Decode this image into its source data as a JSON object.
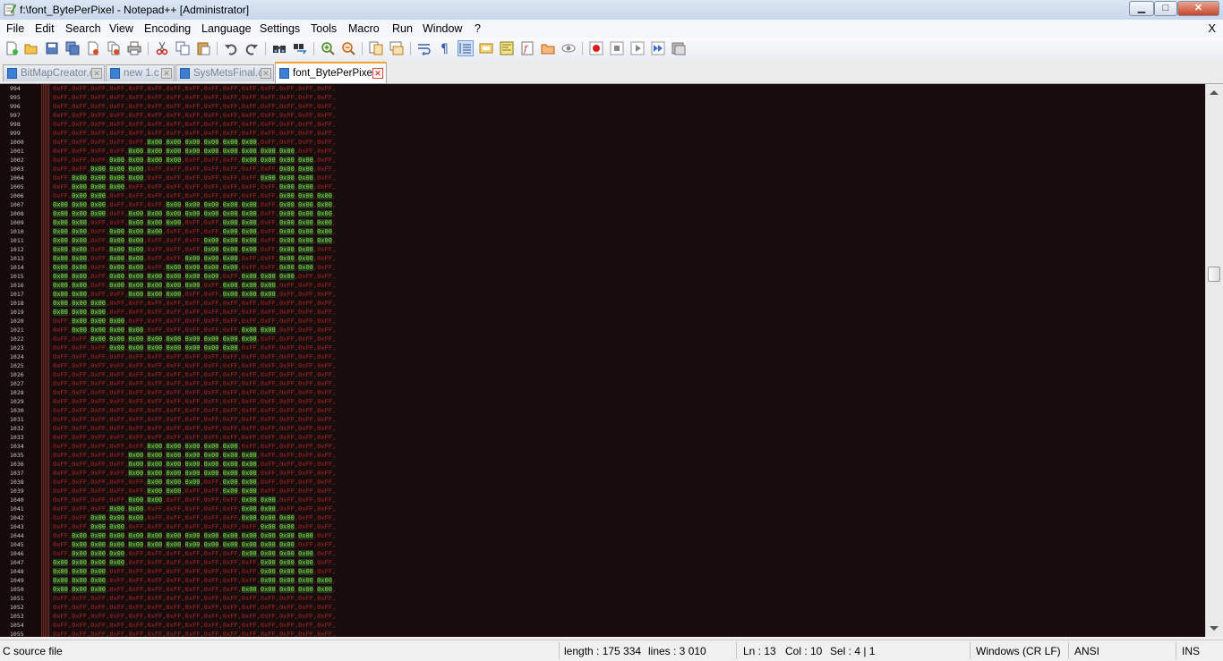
{
  "window": {
    "title": "f:\\font_BytePerPixel - Notepad++ [Administrator]",
    "min_glyph": "▁",
    "max_glyph": "□",
    "close_glyph": "✕",
    "menu_close": "X"
  },
  "menu": {
    "items": [
      "File",
      "Edit",
      "Search",
      "View",
      "Encoding",
      "Language",
      "Settings",
      "Tools",
      "Macro",
      "Run",
      "Window",
      "?"
    ]
  },
  "toolbar": {
    "icons": [
      "new-file-icon",
      "open-file-icon",
      "save-icon",
      "save-all-icon",
      "close-icon",
      "close-all-icon",
      "print-icon",
      "cut-icon",
      "copy-icon",
      "paste-icon",
      "undo-icon",
      "redo-icon",
      "find-icon",
      "replace-icon",
      "zoom-in-icon",
      "zoom-out-icon",
      "sync-vertical-icon",
      "sync-horizontal-icon",
      "word-wrap-icon",
      "show-all-chars-icon",
      "indent-guide-icon",
      "user-language-icon",
      "doc-map-icon",
      "function-list-icon",
      "folder-icon",
      "monitor-icon",
      "record-macro-icon",
      "stop-record-icon",
      "play-macro-icon",
      "run-multiple-macro-icon",
      "save-macro-icon"
    ]
  },
  "tabs": [
    {
      "label": "BitMapCreator.c",
      "active": false
    },
    {
      "label": "new  1.c",
      "active": false
    },
    {
      "label": "SysMetsFinal.c",
      "active": false
    },
    {
      "label": "font_BytePerPixel",
      "active": true
    }
  ],
  "editor": {
    "line_numbers": [
      "994",
      "995",
      "996",
      "997",
      "998",
      "999",
      "1000",
      "1001",
      "1002",
      "1003",
      "1004",
      "1005",
      "1006",
      "1007",
      "1008",
      "1009",
      "1010",
      "1011",
      "1012",
      "1013",
      "1014",
      "1015",
      "1016",
      "1017",
      "1018",
      "1019",
      "1020",
      "1021",
      "1022",
      "1023",
      "1024",
      "1025",
      "1026",
      "1027",
      "1028",
      "1029",
      "1030",
      "1031",
      "1032",
      "1033",
      "1034",
      "1035",
      "1036",
      "1037",
      "1038",
      "1039",
      "1040",
      "1041",
      "1042",
      "1043",
      "1044",
      "1045",
      "1046",
      "1047",
      "1048",
      "1049",
      "1050",
      "1051",
      "1052",
      "1053",
      "1054",
      "1055"
    ],
    "lines": [
      "0xFF,0xFF,0xFF,0xFF,0xFF,0xFF,0xFF,0xFF,0xFF,0xFF,0xFF,0xFF,0xFF,0xFF,0xFF,",
      "0xFF,0xFF,0xFF,0xFF,0xFF,0xFF,0xFF,0xFF,0xFF,0xFF,0xFF,0xFF,0xFF,0xFF,0xFF,",
      "0xFF,0xFF,0xFF,0xFF,0xFF,0xFF,0xFF,0xFF,0xFF,0xFF,0xFF,0xFF,0xFF,0xFF,0xFF,",
      "0xFF,0xFF,0xFF,0xFF,0xFF,0xFF,0xFF,0xFF,0xFF,0xFF,0xFF,0xFF,0xFF,0xFF,0xFF,",
      "0xFF,0xFF,0xFF,0xFF,0xFF,0xFF,0xFF,0xFF,0xFF,0xFF,0xFF,0xFF,0xFF,0xFF,0xFF,",
      "0xFF,0xFF,0xFF,0xFF,0xFF,0xFF,0xFF,0xFF,0xFF,0xFF,0xFF,0xFF,0xFF,0xFF,0xFF,",
      "0xFF,0xFF,0xFF,0xFF,0xFF,0x00,0x00,0x00,0x00,0x00,0x00,0xFF,0xFF,0xFF,0xFF,",
      "0xFF,0xFF,0xFF,0xFF,0x00,0x00,0x00,0x00,0x00,0x00,0x00,0x00,0x00,0xFF,0xFF,",
      "0xFF,0xFF,0xFF,0x00,0x00,0x00,0x00,0xFF,0xFF,0xFF,0x00,0x00,0x00,0x00,0xFF,",
      "0xFF,0xFF,0x00,0x00,0x00,0xFF,0xFF,0xFF,0xFF,0xFF,0xFF,0xFF,0x00,0x00,0xFF,",
      "0xFF,0x00,0x00,0x00,0x00,0xFF,0xFF,0xFF,0xFF,0xFF,0xFF,0x00,0x00,0x00,0xFF,",
      "0xFF,0x00,0x00,0x00,0xFF,0xFF,0xFF,0xFF,0xFF,0xFF,0xFF,0xFF,0x00,0x00,0xFF,",
      "0xFF,0x00,0x00,0xFF,0xFF,0xFF,0xFF,0xFF,0xFF,0xFF,0xFF,0xFF,0x00,0x00,0x00,",
      "0x00,0x00,0x00,0xFF,0xFF,0xFF,0x00,0x00,0x00,0x00,0x00,0xFF,0x00,0x00,0x00,",
      "0x00,0x00,0x00,0xFF,0x00,0x00,0x00,0x00,0x00,0x00,0x00,0xFF,0x00,0x00,0x00,",
      "0x00,0x00,0xFF,0xFF,0x00,0x00,0x00,0xFF,0xFF,0x00,0x00,0xFF,0x00,0x00,0x00,",
      "0x00,0x00,0xFF,0x00,0x00,0x00,0xFF,0xFF,0xFF,0x00,0x00,0xFF,0x00,0x00,0x00,",
      "0x00,0x00,0xFF,0x00,0x00,0xFF,0xFF,0xFF,0x00,0x00,0x00,0xFF,0x00,0x00,0x00,",
      "0x00,0x00,0xFF,0x00,0x00,0xFF,0xFF,0xFF,0x00,0x00,0x00,0xFF,0x00,0x00,0xFF,",
      "0x00,0x00,0xFF,0x00,0x00,0xFF,0xFF,0x00,0x00,0x00,0xFF,0xFF,0x00,0x00,0xFF,",
      "0x00,0x00,0xFF,0x00,0x00,0xFF,0x00,0x00,0x00,0x00,0xFF,0xFF,0x00,0x00,0xFF,",
      "0x00,0x00,0xFF,0x00,0x00,0x00,0x00,0x00,0x00,0xFF,0x00,0x00,0x00,0xFF,0xFF,",
      "0x00,0x00,0xFF,0x00,0x00,0x00,0x00,0x00,0xFF,0x00,0x00,0x00,0xFF,0xFF,0xFF,",
      "0x00,0x00,0xFF,0xFF,0x00,0x00,0x00,0xFF,0xFF,0x00,0x00,0x00,0xFF,0xFF,0xFF,",
      "0x00,0x00,0x00,0xFF,0xFF,0xFF,0xFF,0xFF,0xFF,0xFF,0xFF,0xFF,0xFF,0xFF,0xFF,",
      "0x00,0x00,0x00,0xFF,0xFF,0xFF,0xFF,0xFF,0xFF,0xFF,0xFF,0xFF,0xFF,0xFF,0xFF,",
      "0xFF,0x00,0x00,0x00,0xFF,0xFF,0xFF,0xFF,0xFF,0xFF,0xFF,0xFF,0xFF,0xFF,0xFF,",
      "0xFF,0x00,0x00,0x00,0x00,0xFF,0xFF,0xFF,0xFF,0xFF,0x00,0x00,0xFF,0xFF,0xFF,",
      "0xFF,0xFF,0x00,0x00,0x00,0x00,0x00,0x00,0x00,0x00,0x00,0xFF,0xFF,0xFF,0xFF,",
      "0xFF,0xFF,0xFF,0x00,0x00,0x00,0x00,0x00,0x00,0x00,0xFF,0xFF,0xFF,0xFF,0xFF,",
      "0xFF,0xFF,0xFF,0xFF,0xFF,0xFF,0xFF,0xFF,0xFF,0xFF,0xFF,0xFF,0xFF,0xFF,0xFF,",
      "0xFF,0xFF,0xFF,0xFF,0xFF,0xFF,0xFF,0xFF,0xFF,0xFF,0xFF,0xFF,0xFF,0xFF,0xFF,",
      "0xFF,0xFF,0xFF,0xFF,0xFF,0xFF,0xFF,0xFF,0xFF,0xFF,0xFF,0xFF,0xFF,0xFF,0xFF,",
      "0xFF,0xFF,0xFF,0xFF,0xFF,0xFF,0xFF,0xFF,0xFF,0xFF,0xFF,0xFF,0xFF,0xFF,0xFF,",
      "0xFF,0xFF,0xFF,0xFF,0xFF,0xFF,0xFF,0xFF,0xFF,0xFF,0xFF,0xFF,0xFF,0xFF,0xFF,",
      "0xFF,0xFF,0xFF,0xFF,0xFF,0xFF,0xFF,0xFF,0xFF,0xFF,0xFF,0xFF,0xFF,0xFF,0xFF,",
      "0xFF,0xFF,0xFF,0xFF,0xFF,0xFF,0xFF,0xFF,0xFF,0xFF,0xFF,0xFF,0xFF,0xFF,0xFF,",
      "0xFF,0xFF,0xFF,0xFF,0xFF,0xFF,0xFF,0xFF,0xFF,0xFF,0xFF,0xFF,0xFF,0xFF,0xFF,",
      "0xFF,0xFF,0xFF,0xFF,0xFF,0xFF,0xFF,0xFF,0xFF,0xFF,0xFF,0xFF,0xFF,0xFF,0xFF,",
      "0xFF,0xFF,0xFF,0xFF,0xFF,0xFF,0xFF,0xFF,0xFF,0xFF,0xFF,0xFF,0xFF,0xFF,0xFF,",
      "0xFF,0xFF,0xFF,0xFF,0xFF,0x00,0x00,0x00,0x00,0x00,0xFF,0xFF,0xFF,0xFF,0xFF,",
      "0xFF,0xFF,0xFF,0xFF,0x00,0x00,0x00,0x00,0x00,0x00,0x00,0xFF,0xFF,0xFF,0xFF,",
      "0xFF,0xFF,0xFF,0xFF,0x00,0x00,0x00,0x00,0x00,0x00,0x00,0xFF,0xFF,0xFF,0xFF,",
      "0xFF,0xFF,0xFF,0xFF,0x00,0x00,0x00,0x00,0x00,0x00,0x00,0xFF,0xFF,0xFF,0xFF,",
      "0xFF,0xFF,0xFF,0xFF,0xFF,0x00,0x00,0x00,0xFF,0x00,0x00,0xFF,0xFF,0xFF,0xFF,",
      "0xFF,0xFF,0xFF,0xFF,0xFF,0x00,0x00,0xFF,0xFF,0x00,0x00,0xFF,0xFF,0xFF,0xFF,",
      "0xFF,0xFF,0xFF,0xFF,0x00,0x00,0xFF,0xFF,0xFF,0xFF,0x00,0x00,0xFF,0xFF,0xFF,",
      "0xFF,0xFF,0xFF,0x00,0x00,0xFF,0xFF,0xFF,0xFF,0xFF,0x00,0x00,0xFF,0xFF,0xFF,",
      "0xFF,0xFF,0x00,0x00,0x00,0xFF,0xFF,0xFF,0xFF,0xFF,0x00,0x00,0x00,0xFF,0xFF,",
      "0xFF,0xFF,0x00,0x00,0xFF,0xFF,0xFF,0xFF,0xFF,0xFF,0xFF,0x00,0x00,0xFF,0xFF,",
      "0xFF,0x00,0x00,0x00,0x00,0x00,0x00,0x00,0x00,0x00,0x00,0x00,0x00,0x00,0xFF,",
      "0xFF,0x00,0x00,0x00,0x00,0x00,0x00,0x00,0x00,0x00,0x00,0x00,0x00,0xFF,0xFF,",
      "0xFF,0x00,0x00,0x00,0xFF,0xFF,0xFF,0xFF,0xFF,0xFF,0x00,0x00,0x00,0x00,0xFF,",
      "0x00,0x00,0x00,0x00,0xFF,0xFF,0xFF,0xFF,0xFF,0xFF,0xFF,0x00,0x00,0x00,0xFF,",
      "0x00,0x00,0x00,0xFF,0xFF,0xFF,0xFF,0xFF,0xFF,0xFF,0xFF,0x00,0x00,0x00,0xFF,",
      "0x00,0x00,0x00,0xFF,0xFF,0xFF,0xFF,0xFF,0xFF,0xFF,0xFF,0x00,0x00,0x00,0x00,",
      "0x00,0x00,0x00,0xFF,0xFF,0xFF,0xFF,0xFF,0xFF,0xFF,0x00,0x00,0x00,0x00,0x00,",
      "0xFF,0xFF,0xFF,0xFF,0xFF,0xFF,0xFF,0xFF,0xFF,0xFF,0xFF,0xFF,0xFF,0xFF,0xFF,",
      "0xFF,0xFF,0xFF,0xFF,0xFF,0xFF,0xFF,0xFF,0xFF,0xFF,0xFF,0xFF,0xFF,0xFF,0xFF,",
      "0xFF,0xFF,0xFF,0xFF,0xFF,0xFF,0xFF,0xFF,0xFF,0xFF,0xFF,0xFF,0xFF,0xFF,0xFF,",
      "0xFF,0xFF,0xFF,0xFF,0xFF,0xFF,0xFF,0xFF,0xFF,0xFF,0xFF,0xFF,0xFF,0xFF,0xFF,",
      "0xFF,0xFF,0xFF,0xFF,0xFF,0xFF,0xFF,0xFF,0xFF,0xFF,0xFF,0xFF,0xFF,0xFF,0xFF,"
    ],
    "colors": {
      "background": "#180c0c",
      "text_ff": "#a4262a",
      "text_00": "#93d84a",
      "line_number": "#c9c9c9"
    }
  },
  "scrollbar": {
    "position_fraction": 0.33
  },
  "status": {
    "file_type": "C source file",
    "length": "length : 175 334",
    "lines": "lines : 3 010",
    "ln": "Ln : 13",
    "col": "Col : 10",
    "sel": "Sel : 4 | 1",
    "eol": "Windows (CR LF)",
    "encoding": "ANSI",
    "mode": "INS"
  }
}
